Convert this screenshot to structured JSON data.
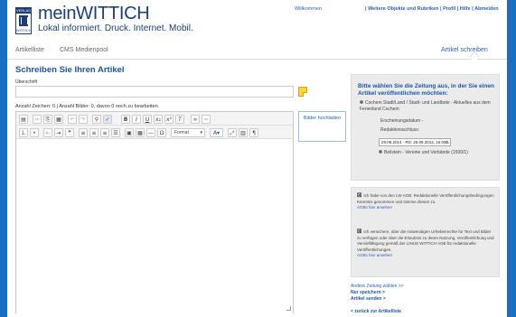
{
  "header": {
    "logo_top": "VERLAG",
    "logo_bottom": "WITTICH",
    "brand": "meinWITTICH",
    "tagline": "Lokal informiert. Druck. Internet. Mobil.",
    "welcome": "Willkommen",
    "toplinks": "| Weitere Objekte und Rubriken | Profil | Hilfe | Abmelden"
  },
  "nav": {
    "items": [
      "Artikelliste",
      "CMS Medienpool"
    ],
    "active": "Artikel schreiben"
  },
  "main": {
    "heading": "Schreiben Sie Ihren Artikel",
    "title_label": "Überschrift",
    "title_value": "",
    "counter": "Anzahl Zeichen: 0  |  Anzahl Bilder: 0, davon 0 noch zu bearbeiten.",
    "format_label": "Format",
    "upload_label": "Bilder hochladen"
  },
  "icons": {
    "note": "sticky-note-icon",
    "row1": [
      "source-icon",
      "cut-icon",
      "copy-icon",
      "paste-icon",
      "undo-icon",
      "redo-icon",
      "find-icon",
      "spellcheck-icon",
      "bold-icon",
      "italic-icon",
      "underline-icon",
      "subscript-icon",
      "superscript-icon",
      "remove-format-icon",
      "link-icon",
      "unlink-icon"
    ],
    "row2": [
      "numbered-list-icon",
      "bullet-list-icon",
      "outdent-icon",
      "indent-icon",
      "blockquote-icon",
      "align-left-icon",
      "align-center-icon",
      "align-right-icon",
      "justify-icon",
      "image-icon",
      "table-icon",
      "horizontal-rule-icon",
      "special-char-icon",
      "format-select",
      "text-color-icon",
      "maximize-icon",
      "show-blocks-icon",
      "paragraph-icon"
    ]
  },
  "sidebar": {
    "prompt": "Bitte wählen Sie die Zeitung aus, in der Sie einen Artikel veröffentlichen möchten:",
    "option1": "Cochem Stadt/Land / Stadt- und Landbote - Aktuelles aus dem Ferienland Cochem",
    "release_label": "Erscheinungsdatum -",
    "deadline_label": "Redaktionsschluss:",
    "date_select": "29.08.2014 - RS: 25.08.2014, 16:00 L",
    "option2": "Beilstein - Vereine und Verbände (1500/1)",
    "agb_text": "Ich habe von den LW AGB: Redaktionelle Veröffentlichungsbedingungen Kenntnis genommen und stimme diesen zu.",
    "agb_link": "AGBs hier ansehen",
    "rights_text": "Ich versichere, über die notwendigen Urheberrechte für Text und Bilder zu verfügen oder über die Erlaubnis zu deren Nutzung, Veröffentlichung und Vervielfältigung gemäß der LINUS WITTICH AGB für redaktionelle Veröffentlichungen.",
    "rights_link": "AGBs hier ansehen",
    "choose_other": "Andere Zeitung wählen >>",
    "save_only": "Nur speichern >",
    "send": "Artikel senden >",
    "back": "< zurück zur Artikelliste"
  },
  "colors": {
    "accent": "#1a56a8",
    "background": "#1a6fc2",
    "note": "#ffd24d"
  }
}
